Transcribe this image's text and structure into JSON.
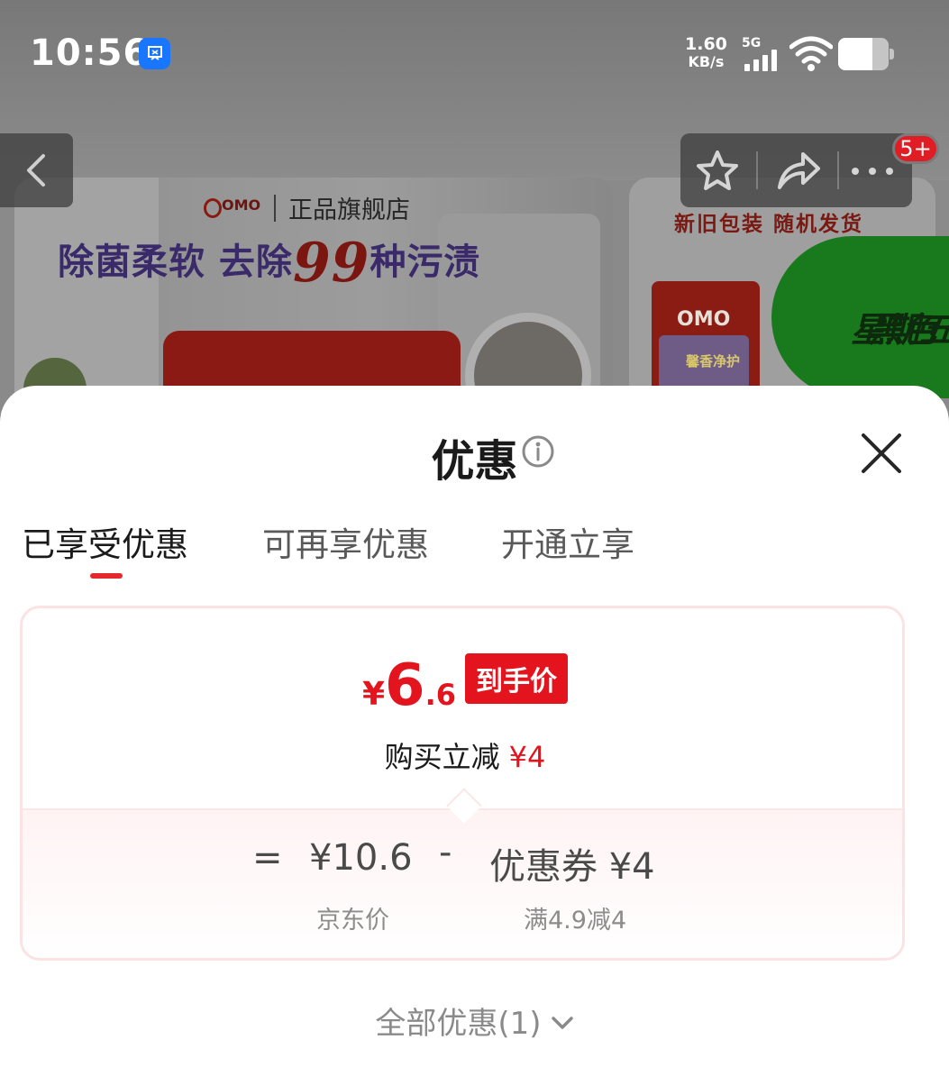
{
  "status_bar": {
    "time": "10:56",
    "net_speed_value": "1.60",
    "net_speed_unit": "KB/s",
    "network_type": "5G"
  },
  "background": {
    "store_label": "正品旗舰店",
    "brand_mini": "OMO",
    "slogan_part1": "除菌柔软 去除",
    "slogan_number": "99",
    "slogan_part2": "种污渍",
    "side_banner_text": "新旧包装 随机发货",
    "side_bag_brand": "OMO",
    "side_bag_product": "馨香净护",
    "promo_badge_line1": "黑色",
    "promo_badge_line2": "星期五"
  },
  "nav": {
    "message_badge": "5+"
  },
  "sheet": {
    "title": "优惠",
    "tabs": [
      {
        "label": "已享受优惠",
        "active": true
      },
      {
        "label": "可再享优惠",
        "active": false
      },
      {
        "label": "开通立享",
        "active": false
      }
    ],
    "card": {
      "currency": "¥",
      "price_integer": "6",
      "price_decimal": ".6",
      "price_tag": "到手价",
      "saving_label": "购买立减",
      "saving_amount": "¥4",
      "formula": {
        "equals": "=",
        "base_price": "¥10.6",
        "minus": "-",
        "coupon": "优惠券 ¥4",
        "base_price_label": "京东价",
        "coupon_label": "满4.9减4"
      }
    },
    "all_deals_label": "全部优惠(1)"
  },
  "colors": {
    "accent_red": "#e4141e",
    "tab_indicator": "#e4282e",
    "card_border": "#fde2e4"
  }
}
